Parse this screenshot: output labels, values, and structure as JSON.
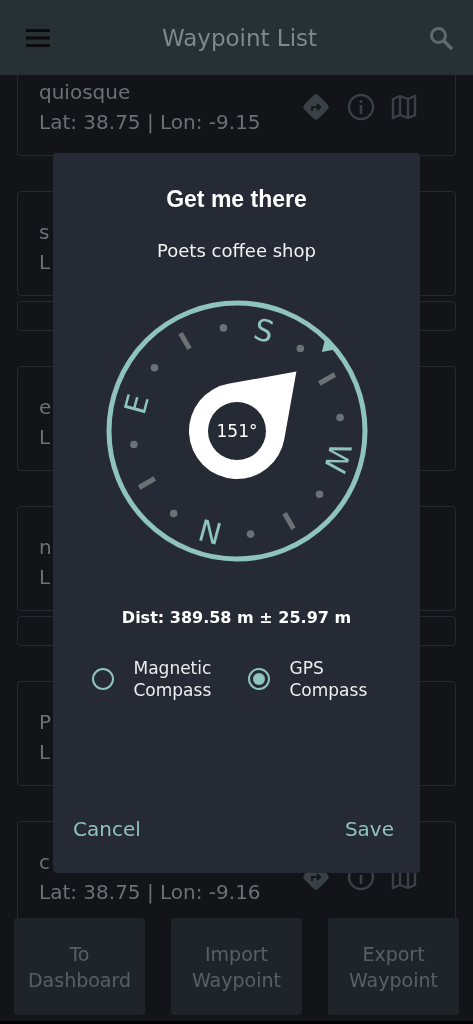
{
  "app_bar": {
    "title": "Waypoint List"
  },
  "waypoints": [
    {
      "kind": "card",
      "name": "quiosque",
      "coords": "Lat: 38.75 | Lon: -9.15",
      "actions": true
    },
    {
      "kind": "card",
      "name": "s",
      "coords": "L"
    },
    {
      "kind": "strip"
    },
    {
      "kind": "card",
      "name": "e",
      "coords": "L"
    },
    {
      "kind": "card",
      "name": "n",
      "coords": "L"
    },
    {
      "kind": "strip"
    },
    {
      "kind": "card",
      "name": "P",
      "coords": "L"
    },
    {
      "kind": "card",
      "name": "c",
      "coords": "Lat: 38.75 | Lon: -9.16",
      "actions": true
    }
  ],
  "bottom_buttons": [
    {
      "label": "To Dashboard"
    },
    {
      "label": "Import Waypoint"
    },
    {
      "label": "Export Waypoint"
    }
  ],
  "dialog": {
    "title": "Get me there",
    "subtitle": "Poets coffee shop",
    "compass": {
      "heading": "151°",
      "dial_labels": [
        "N",
        "E",
        "S",
        "W"
      ]
    },
    "distance": "Dist: 389.58 m ± 25.97 m",
    "options": [
      {
        "label": "Magnetic Compass",
        "selected": false
      },
      {
        "label": "GPS Compass",
        "selected": true
      }
    ],
    "buttons": [
      {
        "label": "Cancel"
      },
      {
        "label": "Save"
      }
    ]
  }
}
